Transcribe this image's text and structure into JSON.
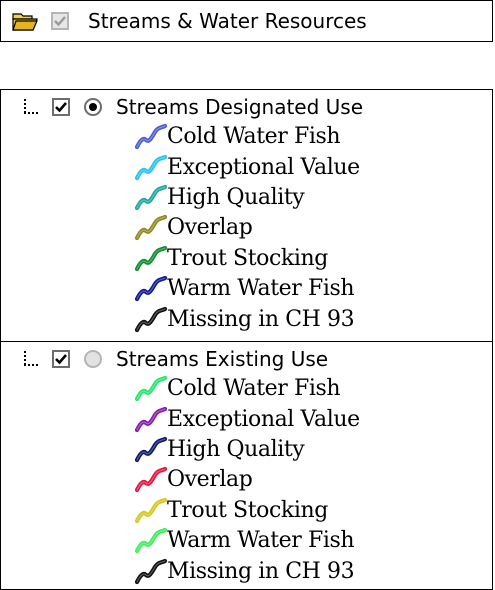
{
  "group": {
    "title": "Streams & Water Resources",
    "icon": "folder-open-icon",
    "checkbox_state": "checked-disabled"
  },
  "layers": [
    {
      "label": "Streams Designated Use",
      "checked": true,
      "radio_selected": true,
      "legend": [
        {
          "label": "Cold Water Fish",
          "color": "#4a5fd6",
          "icon": "stream-line-icon"
        },
        {
          "label": "Exceptional Value",
          "color": "#22c4f2",
          "icon": "stream-line-icon"
        },
        {
          "label": "High Quality",
          "color": "#1ba8a0",
          "icon": "stream-line-icon"
        },
        {
          "label": "Overlap",
          "color": "#8e8a20",
          "icon": "stream-line-icon"
        },
        {
          "label": "Trout Stocking",
          "color": "#0f8c2c",
          "icon": "stream-line-icon"
        },
        {
          "label": "Warm Water Fish",
          "color": "#0c1a9a",
          "icon": "stream-line-icon"
        },
        {
          "label": "Missing in CH 93",
          "color": "#111111",
          "icon": "stream-line-icon"
        }
      ]
    },
    {
      "label": "Streams Existing Use",
      "checked": true,
      "radio_selected": false,
      "legend": [
        {
          "label": "Cold Water Fish",
          "color": "#22e86a",
          "icon": "stream-line-icon"
        },
        {
          "label": "Exceptional Value",
          "color": "#8a1ab0",
          "icon": "stream-line-icon"
        },
        {
          "label": "High Quality",
          "color": "#0c1a6a",
          "icon": "stream-line-icon"
        },
        {
          "label": "Overlap",
          "color": "#e8143a",
          "icon": "stream-line-icon"
        },
        {
          "label": "Trout Stocking",
          "color": "#d6c81a",
          "icon": "stream-line-icon"
        },
        {
          "label": "Warm Water Fish",
          "color": "#3af05a",
          "icon": "stream-line-icon"
        },
        {
          "label": "Missing in CH 93",
          "color": "#111111",
          "icon": "stream-line-icon"
        }
      ]
    }
  ]
}
